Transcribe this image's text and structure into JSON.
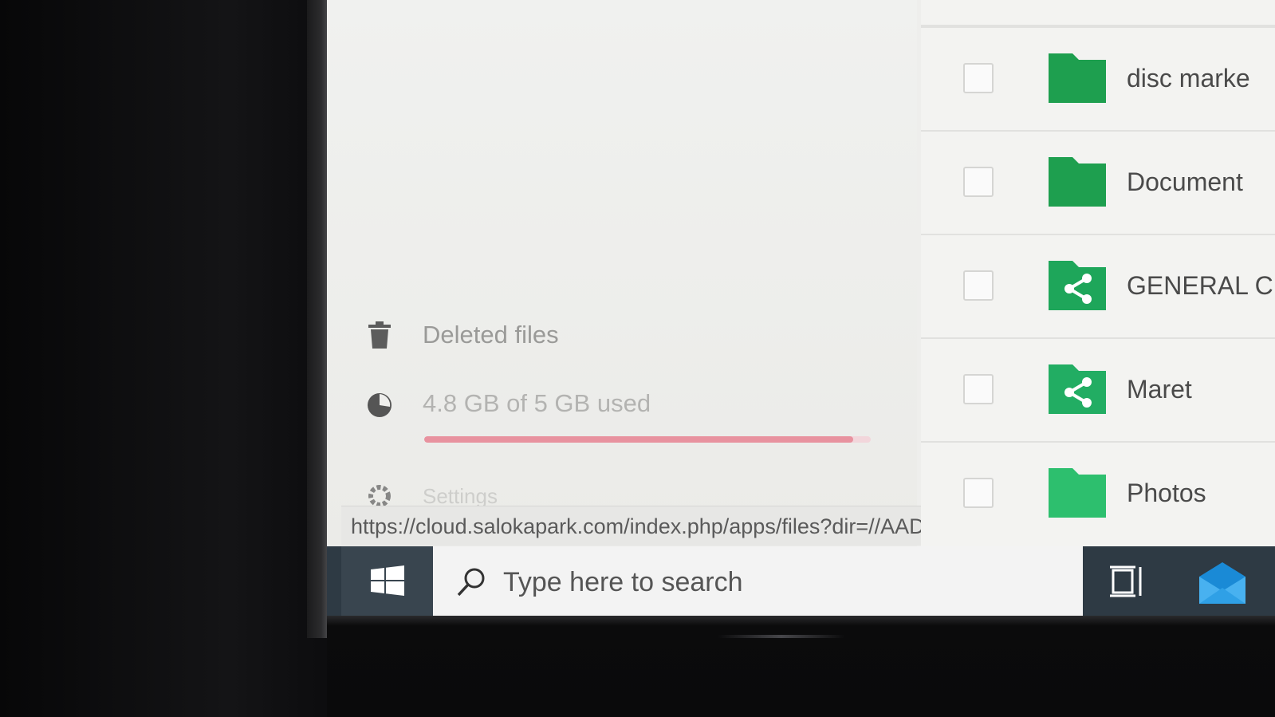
{
  "sidebar": {
    "deleted_files": "Deleted files",
    "quota_text": "4.8 GB of 5 GB used",
    "quota_fraction": 0.96,
    "settings_label": "Settings"
  },
  "files": [
    {
      "name": "disc marke",
      "type": "folder"
    },
    {
      "name": "Document",
      "type": "folder"
    },
    {
      "name": "GENERAL C",
      "type": "shared-folder"
    },
    {
      "name": "Maret",
      "type": "shared-folder"
    },
    {
      "name": "Photos",
      "type": "folder"
    }
  ],
  "status_url": "https://cloud.salokapark.com/index.php/apps/files?dir=//AADMIN ME",
  "taskbar": {
    "search_placeholder": "Type here to search"
  },
  "colors": {
    "folder_green": "#1e9f4f",
    "quota_bar": "#e8929f",
    "taskbar": "#2e3a44"
  },
  "icons": [
    "trash-icon",
    "pie-chart-icon",
    "gear-icon",
    "folder-icon",
    "share-icon",
    "windows-logo-icon",
    "search-icon",
    "task-view-icon",
    "mail-icon"
  ]
}
